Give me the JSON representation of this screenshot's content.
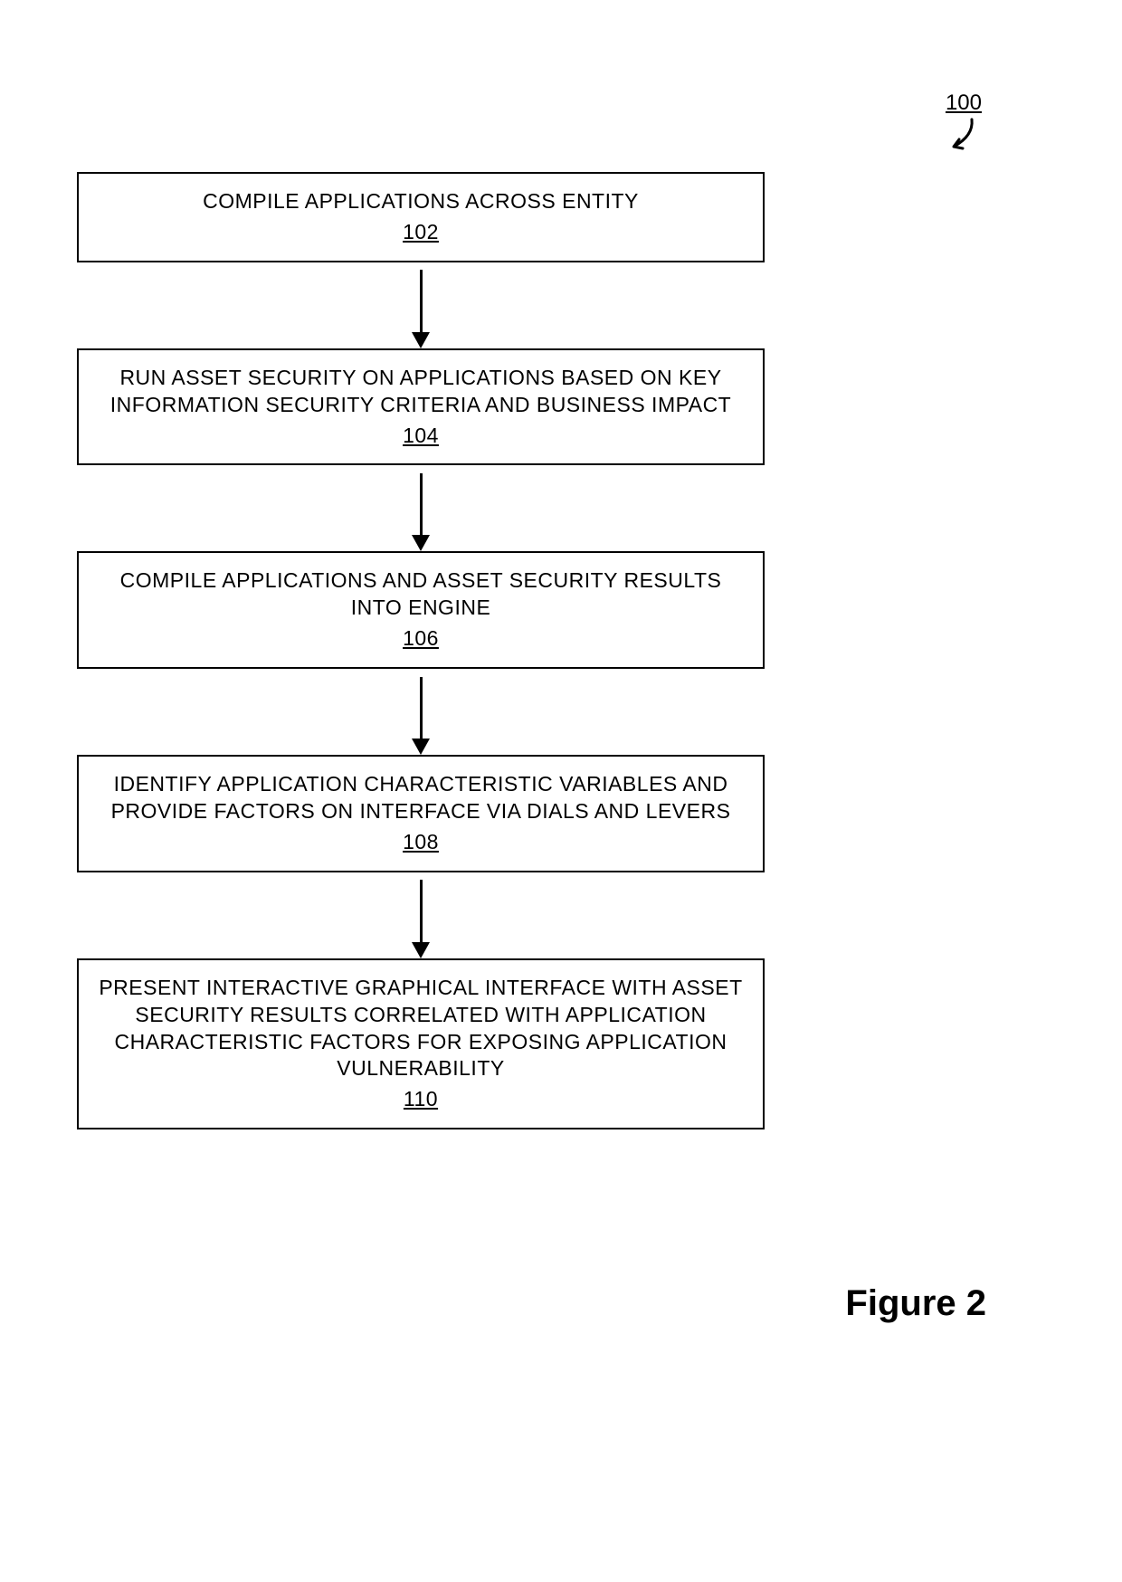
{
  "chart_data": {
    "type": "flowchart",
    "reference_number": "100",
    "figure_label": "Figure 2",
    "steps": [
      {
        "id": "102",
        "text": "COMPILE APPLICATIONS ACROSS ENTITY"
      },
      {
        "id": "104",
        "text": "RUN ASSET SECURITY ON APPLICATIONS BASED ON KEY INFORMATION SECURITY CRITERIA AND BUSINESS IMPACT"
      },
      {
        "id": "106",
        "text": "COMPILE APPLICATIONS AND ASSET SECURITY RESULTS INTO ENGINE"
      },
      {
        "id": "108",
        "text": "IDENTIFY APPLICATION CHARACTERISTIC VARIABLES AND PROVIDE FACTORS ON INTERFACE VIA DIALS AND LEVERS"
      },
      {
        "id": "110",
        "text": "PRESENT INTERACTIVE GRAPHICAL INTERFACE WITH ASSET SECURITY RESULTS CORRELATED WITH APPLICATION CHARACTERISTIC FACTORS FOR EXPOSING APPLICATION VULNERABILITY"
      }
    ]
  }
}
